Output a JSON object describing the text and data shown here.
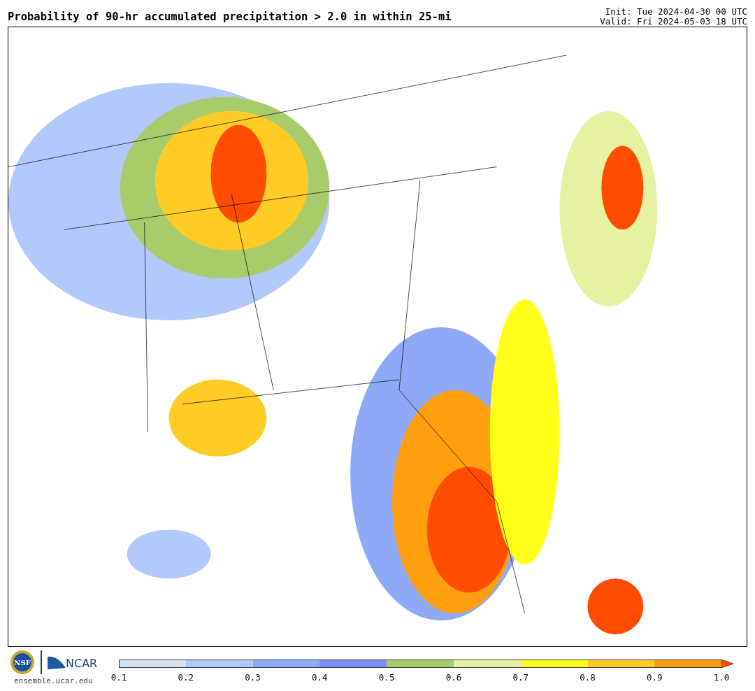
{
  "header": {
    "title": "Probability of 90-hr accumulated precipitation > 2.0 in within 25-mi",
    "init": "Init: Tue 2024-04-30 00 UTC",
    "valid": "Valid: Fri 2024-05-03 18 UTC"
  },
  "footer": {
    "seal_text": "NSF",
    "logo_text": "NCAR",
    "site": "ensemble.ucar.edu"
  },
  "legend": {
    "bins": [
      {
        "color": "#d6e2ef"
      },
      {
        "color": "#b3c8fb"
      },
      {
        "color": "#8fa9f7"
      },
      {
        "color": "#7c8ef5"
      },
      {
        "color": "#a8cc6a"
      },
      {
        "color": "#e6f2a2"
      },
      {
        "color": "#ffff1a"
      },
      {
        "color": "#ffcc26"
      },
      {
        "color": "#ff9f10"
      }
    ],
    "extend": {
      "color": "#ff4c00"
    },
    "ticks": [
      "0.1",
      "0.2",
      "0.3",
      "0.4",
      "0.5",
      "0.6",
      "0.7",
      "0.8",
      "0.9",
      "1.0"
    ]
  }
}
